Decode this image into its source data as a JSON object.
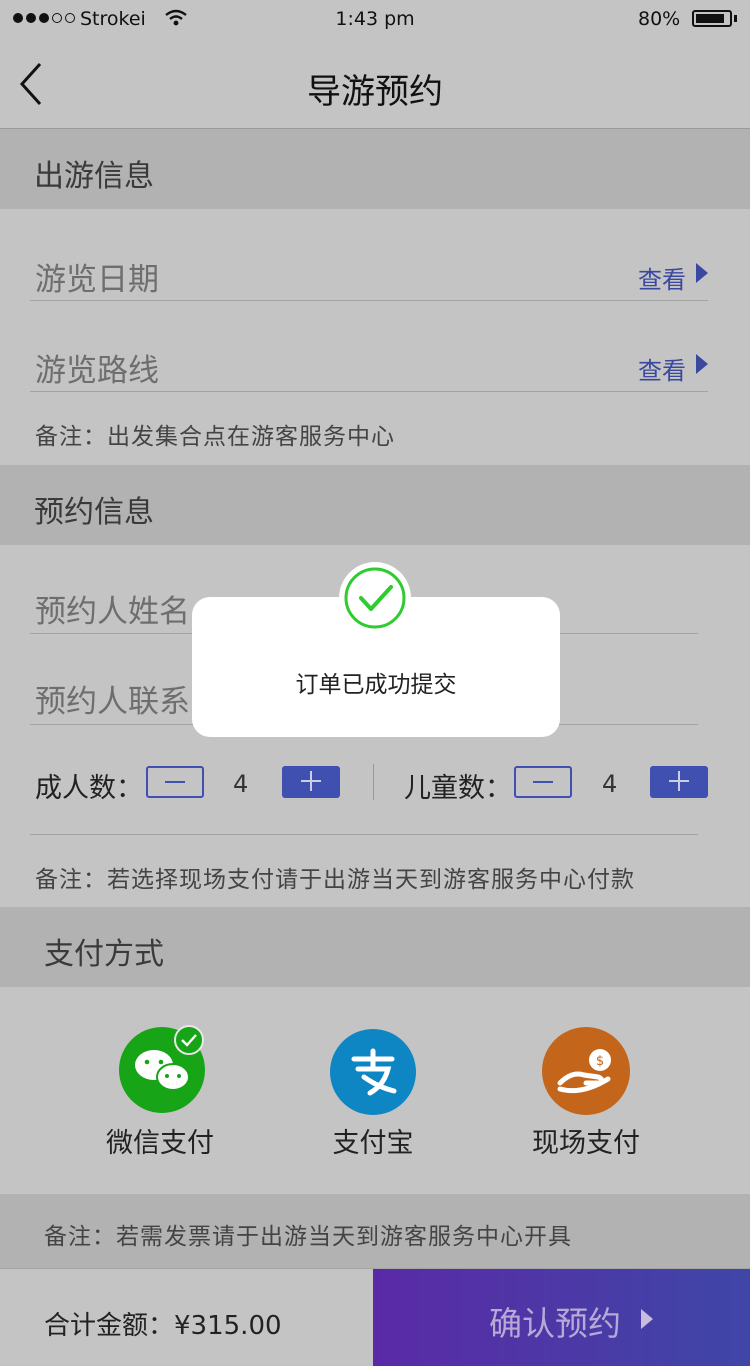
{
  "status_bar": {
    "carrier": "Strokei",
    "time": "1:43 pm",
    "battery": "80%"
  },
  "nav": {
    "title": "导游预约"
  },
  "trip_info": {
    "header": "出游信息",
    "date_label": "游览日期",
    "route_label": "游览路线",
    "view_label": "查看",
    "note": "备注：出发集合点在游客服务中心"
  },
  "booking_info": {
    "header": "预约信息",
    "name_placeholder": "预约人姓名",
    "contact_placeholder": "预约人联系",
    "adults_label": "成人数：",
    "adults_count": "4",
    "children_label": "儿童数：",
    "children_count": "4",
    "note": "备注：若选择现场支付请于出游当天到游客服务中心付款"
  },
  "payment": {
    "header": "支付方式",
    "methods": [
      {
        "label": "微信支付",
        "icon": "wechat-pay-icon",
        "color": "#17a417",
        "selected": true
      },
      {
        "label": "支付宝",
        "icon": "alipay-icon",
        "color": "#0f86c4",
        "selected": false
      },
      {
        "label": "现场支付",
        "icon": "cash-hand-icon",
        "color": "#c4651c",
        "selected": false
      }
    ],
    "note": "备注：若需发票请于出游当天到游客服务中心开具"
  },
  "footer": {
    "total_label": "合计金额：",
    "total_value": "¥315.00",
    "confirm_label": "确认预约"
  },
  "toast": {
    "message": "订单已成功提交",
    "icon": "success-check-icon"
  },
  "colors": {
    "accent": "#3f50b0",
    "confirm_start": "#5a2aa6",
    "confirm_end": "#3f46a7",
    "success": "#2ecc2e"
  }
}
